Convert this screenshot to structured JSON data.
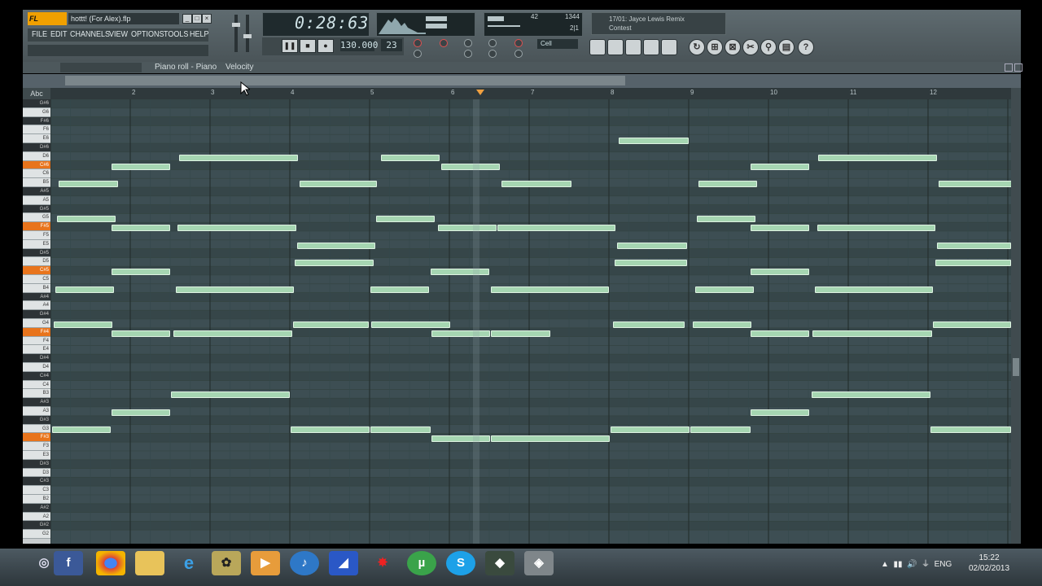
{
  "window": {
    "logo": "FL STUDIO",
    "title": "hottt! (For Alex).flp"
  },
  "menu": [
    "FILE",
    "EDIT",
    "CHANNELS",
    "VIEW",
    "OPTIONS",
    "TOOLS",
    "HELP"
  ],
  "transport": {
    "time": "0:28:63",
    "tempo": "130.000",
    "snap_value": "23"
  },
  "cpu": {
    "value1": "42",
    "value2": "1344",
    "value3": "2|1"
  },
  "cell_label": "Cell",
  "song": {
    "line1": "17/01: Jayce Lewis Remix",
    "line2": "Contest"
  },
  "pianoroll": {
    "title": "Piano roll - Piano",
    "velocity": "Velocity",
    "abc": "Abc",
    "bars": [
      "2",
      "3",
      "4",
      "5",
      "6",
      "7",
      "8",
      "9",
      "10",
      "11",
      "12"
    ]
  },
  "keys": [
    "G#6",
    "G6",
    "F#6",
    "F6",
    "E6",
    "D#6",
    "D6",
    "C#6",
    "C6",
    "B5",
    "A#5",
    "A5",
    "G#5",
    "G5",
    "F#5",
    "F5",
    "E5",
    "D#5",
    "D5",
    "C#5",
    "C5",
    "B4",
    "A#4",
    "A4",
    "G#4",
    "G4",
    "F#4",
    "F4",
    "E4",
    "D#4",
    "D4",
    "C#4",
    "C4",
    "B3",
    "A#3",
    "A3",
    "G#3",
    "G3",
    "F#3",
    "F3",
    "E3",
    "D#3",
    "D3",
    "C#3",
    "C3",
    "B2",
    "A#2",
    "A2",
    "G#2",
    "G2"
  ],
  "taskbar": {
    "icons": [
      "start-orb",
      "facebook",
      "chrome",
      "explorer",
      "internet-explorer",
      "fl-studio",
      "media-player",
      "itunes",
      "app-blue",
      "app-red",
      "utorrent",
      "skype",
      "app-dark",
      "app-gray"
    ],
    "language": "ENG",
    "time": "15:22",
    "date": "02/02/2013"
  },
  "colors": {
    "note": "#a6d6b2",
    "grid": "#3d4e53",
    "highlight_key": "#e8741c",
    "accent": "#f0a000"
  }
}
